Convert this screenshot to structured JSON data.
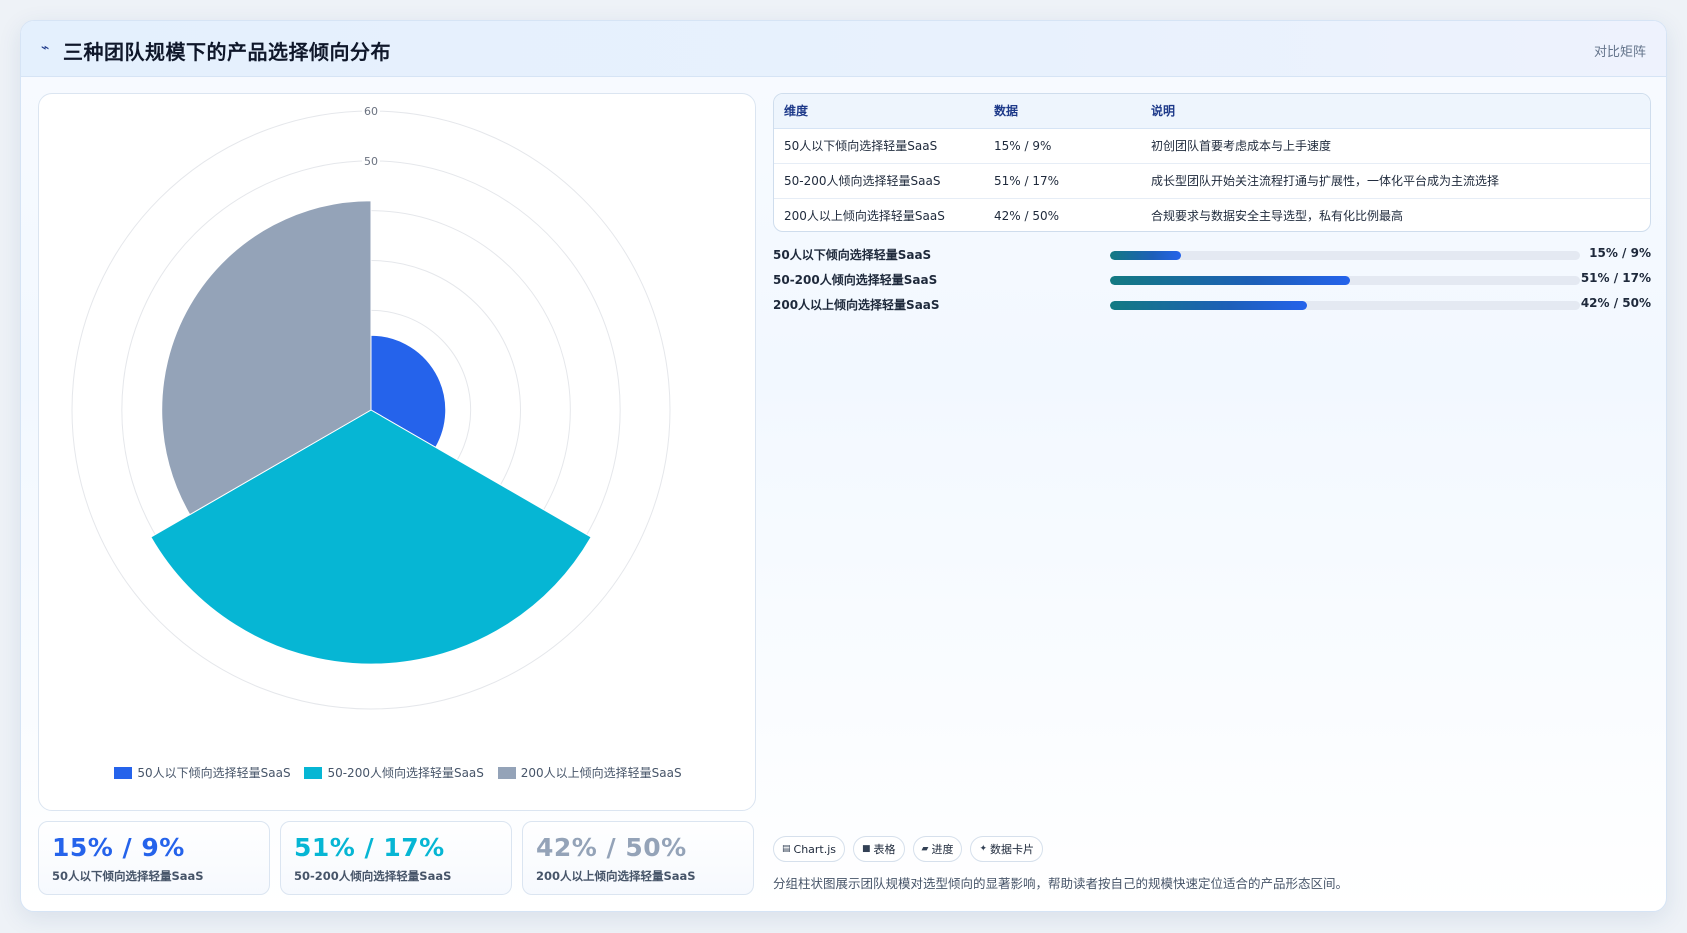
{
  "header": {
    "title": "三种团队规模下的产品选择倾向分布",
    "tag": "对比矩阵",
    "icon": "chart-line-icon"
  },
  "chart_data": {
    "type": "polarArea",
    "title": "",
    "categories": [
      "50人以下倾向选择轻量SaaS",
      "50-200人倾向选择轻量SaaS",
      "200人以上倾向选择轻量SaaS"
    ],
    "values": [
      15,
      51,
      42
    ],
    "colors": [
      "#2563eb",
      "#06b6d4",
      "#94a3b8"
    ],
    "r_ticks": [
      10,
      20,
      30,
      40,
      50,
      60
    ],
    "r_tick_labels_visible": [
      "50",
      "60"
    ],
    "rlim": [
      0,
      60
    ],
    "legend": "bottom",
    "grid": true
  },
  "stats": [
    {
      "value": "15% / 9%",
      "label": "50人以下倾向选择轻量SaaS",
      "color": "#2563eb"
    },
    {
      "value": "51% / 17%",
      "label": "50-200人倾向选择轻量SaaS",
      "color": "#06b6d4"
    },
    {
      "value": "42% / 50%",
      "label": "200人以上倾向选择轻量SaaS",
      "color": "#94a3b8"
    }
  ],
  "table": {
    "headers": [
      "维度",
      "数据",
      "说明"
    ],
    "rows": [
      [
        "50人以下倾向选择轻量SaaS",
        "15% / 9%",
        "初创团队首要考虑成本与上手速度"
      ],
      [
        "50-200人倾向选择轻量SaaS",
        "51% / 17%",
        "成长型团队开始关注流程打通与扩展性，一体化平台成为主流选择"
      ],
      [
        "200人以上倾向选择轻量SaaS",
        "42% / 50%",
        "合规要求与数据安全主导选型，私有化比例最高"
      ]
    ]
  },
  "progress": [
    {
      "label": "50人以下倾向选择轻量SaaS",
      "value_text": "15% / 9%",
      "percent": 15
    },
    {
      "label": "50-200人倾向选择轻量SaaS",
      "value_text": "51% / 17%",
      "percent": 51
    },
    {
      "label": "200人以上倾向选择轻量SaaS",
      "value_text": "42% / 50%",
      "percent": 42
    }
  ],
  "chips": [
    {
      "label": "Chart.js",
      "icon": "chart-icon",
      "glyph": "▤"
    },
    {
      "label": "表格",
      "icon": "table-icon",
      "glyph": "■"
    },
    {
      "label": "进度",
      "icon": "progress-icon",
      "glyph": "▰"
    },
    {
      "label": "数据卡片",
      "icon": "card-icon",
      "glyph": "✦"
    }
  ],
  "note": "分组柱状图展示团队规模对选型倾向的显著影响，帮助读者按自己的规模快速定位适合的产品形态区间。"
}
